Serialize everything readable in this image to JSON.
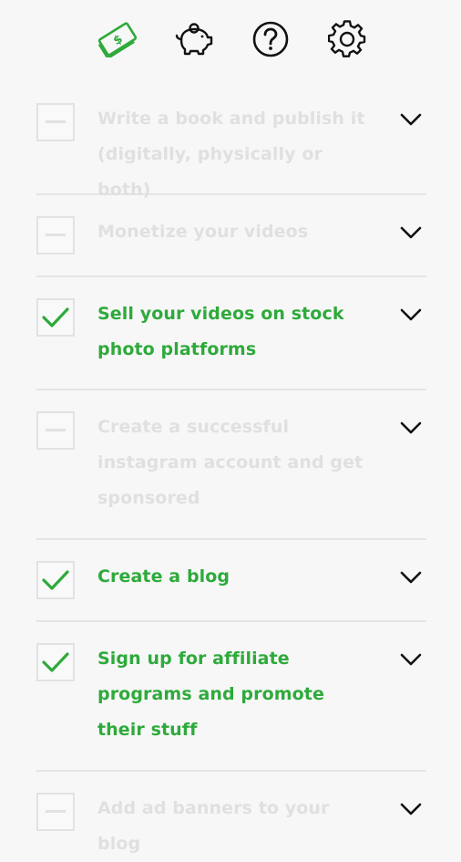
{
  "nav": {
    "icons": [
      {
        "name": "money-icon",
        "active": true
      },
      {
        "name": "piggy-bank-icon",
        "active": false
      },
      {
        "name": "help-icon",
        "active": false
      },
      {
        "name": "settings-icon",
        "active": false
      }
    ]
  },
  "colors": {
    "accent": "#2eaa3b",
    "inactive_text": "#e0e0e0",
    "icon": "#111111"
  },
  "tasks": [
    {
      "label": "Write a book and publish it (digitally, physically or both)",
      "checked": false
    },
    {
      "label": "Monetize your videos",
      "checked": false
    },
    {
      "label": "Sell your videos on stock photo platforms",
      "checked": true
    },
    {
      "label": "Create a successful instagram account and get sponsored",
      "checked": false
    },
    {
      "label": "Create a blog",
      "checked": true
    },
    {
      "label": "Sign up for affiliate programs and promote their stuff",
      "checked": true
    },
    {
      "label": "Add ad banners to your blog",
      "checked": false
    }
  ]
}
